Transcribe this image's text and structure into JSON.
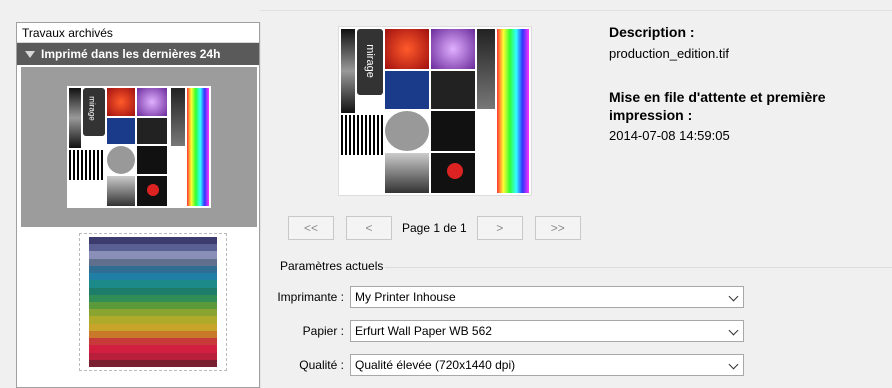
{
  "left_panel": {
    "title": "Travaux archivés",
    "group_header": "Imprimé dans les dernières 24h"
  },
  "thumbnail_text": "mirage",
  "stripe_colors": [
    "#3b3b6e",
    "#5a5f93",
    "#8a8fb8",
    "#5f6f8c",
    "#2f6d93",
    "#1f7fa5",
    "#1d8a8a",
    "#1d7d6a",
    "#2f8d55",
    "#5a9a3a",
    "#8aa52f",
    "#b0aa2a",
    "#c8a52a",
    "#c87a2a",
    "#c83a3a",
    "#d21f3f",
    "#b81f3a",
    "#7a1f2f"
  ],
  "pagination": {
    "first": "<<",
    "prev": "<",
    "page_label": "Page 1 de 1",
    "next": ">",
    "last": ">>"
  },
  "details": {
    "description_label": "Description :",
    "description_value": "production_edition.tif",
    "queue_label": "Mise en file d'attente et première impression :",
    "queue_value": "2014-07-08 14:59:05"
  },
  "settings": {
    "legend": "Paramètres actuels",
    "printer_label": "Imprimante :",
    "printer_value": "My Printer Inhouse",
    "paper_label": "Papier :",
    "paper_value": "Erfurt Wall Paper WB 562",
    "quality_label": "Qualité :",
    "quality_value": "Qualité élevée (720x1440 dpi)"
  }
}
